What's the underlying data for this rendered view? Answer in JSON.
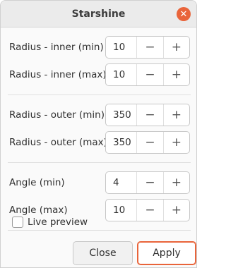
{
  "window": {
    "title": "Starshine"
  },
  "params": [
    {
      "label": "Radius - inner (min)",
      "value": "10"
    },
    {
      "label": "Radius - inner (max)",
      "value": "10"
    },
    {
      "label": "Radius - outer (min)",
      "value": "350"
    },
    {
      "label": "Radius - outer (max)",
      "value": "350"
    },
    {
      "label": "Angle (min)",
      "value": "4"
    },
    {
      "label": "Angle (max)",
      "value": "10"
    }
  ],
  "controls": {
    "minus": "−",
    "plus": "+",
    "close_glyph": "✕"
  },
  "preview": {
    "label": "Live preview",
    "checked": false
  },
  "buttons": {
    "close": "Close",
    "apply": "Apply"
  },
  "colors": {
    "accent": "#e9643a"
  }
}
